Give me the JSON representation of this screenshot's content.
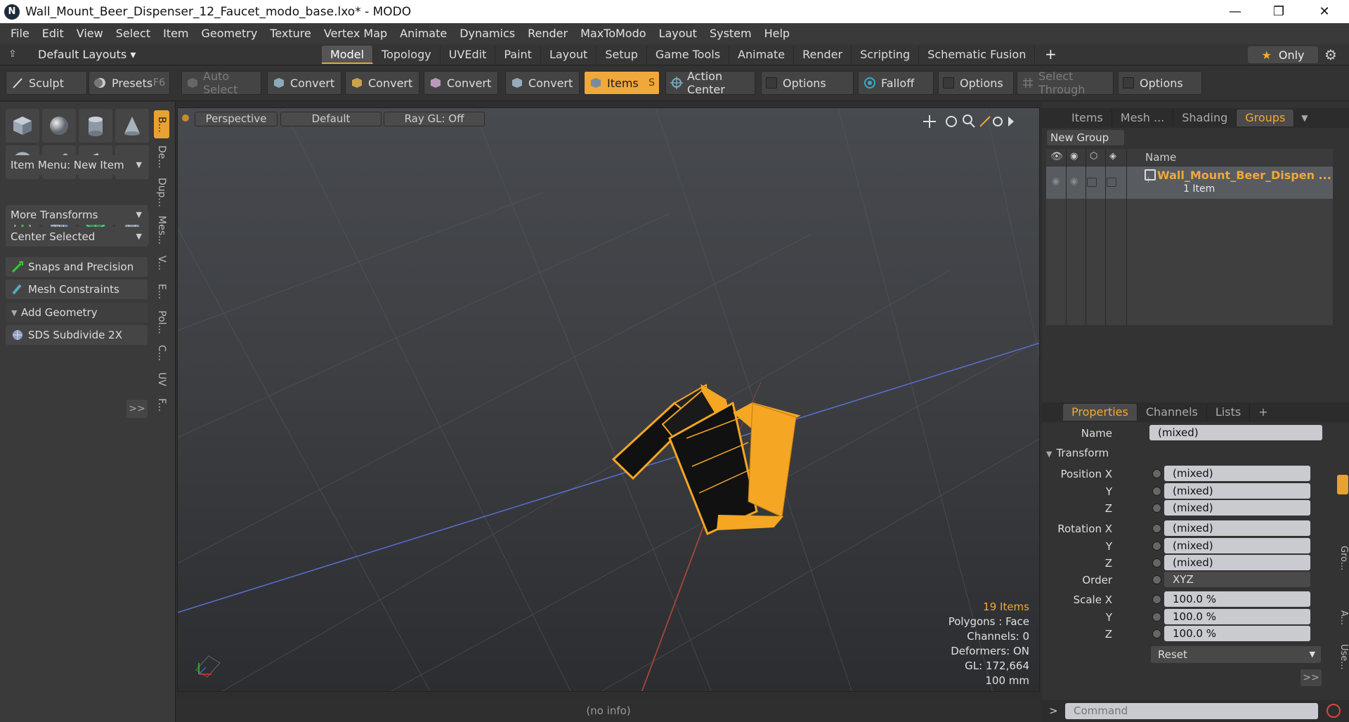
{
  "window": {
    "title": "Wall_Mount_Beer_Dispenser_12_Faucet_modo_base.lxo* - MODO",
    "logo": "N",
    "controls": [
      "—",
      "❐",
      "✕"
    ]
  },
  "menu": [
    "File",
    "Edit",
    "View",
    "Select",
    "Item",
    "Geometry",
    "Texture",
    "Vertex Map",
    "Animate",
    "Dynamics",
    "Render",
    "MaxToModo",
    "Layout",
    "System",
    "Help"
  ],
  "layout_bar": {
    "layouts_label": "Default Layouts ▾",
    "tabs": [
      "Model",
      "Topology",
      "UVEdit",
      "Paint",
      "Layout",
      "Setup",
      "Game Tools",
      "Animate",
      "Render",
      "Scripting",
      "Schematic Fusion"
    ],
    "active_tab": "Model",
    "plus": "+",
    "only_label": "Only",
    "only_star": "★"
  },
  "toolbar": {
    "sculpt": "Sculpt",
    "presets": "Presets",
    "presets_key": "F6",
    "auto_select": "Auto Select",
    "convert": "Convert",
    "items": "Items",
    "items_key": "S",
    "action_center": "Action Center",
    "options": "Options",
    "falloff": "Falloff",
    "select_through": "Select Through"
  },
  "left_panel": {
    "item_menu": "Item Menu: New Item",
    "more_transforms": "More Transforms",
    "center_selected": "Center Selected",
    "snaps": "Snaps and Precision",
    "mesh_constraints": "Mesh Constraints",
    "add_geometry": "Add Geometry",
    "sds": "SDS Subdivide 2X",
    "expand": ">>",
    "vtabs": [
      "B...",
      "De...",
      "Dup...",
      "Mes...",
      "V...",
      "E...",
      "Pol...",
      "C...",
      "UV",
      "F..."
    ]
  },
  "viewport": {
    "view": "Perspective",
    "shading": "Default",
    "raygl": "Ray GL: Off",
    "info": {
      "items": "19 Items",
      "polygons": "Polygons : Face",
      "channels": "Channels: 0",
      "deformers": "Deformers: ON",
      "gl": "GL: 172,664",
      "scale": "100 mm"
    },
    "status": "(no info)"
  },
  "groups_panel": {
    "tabs": [
      "Items",
      "Mesh ...",
      "Shading",
      "Groups"
    ],
    "active_tab": "Groups",
    "new_group": "New Group",
    "col_name": "Name",
    "group_name": "Wall_Mount_Beer_Dispen ...",
    "group_count": "1 Item"
  },
  "properties_panel": {
    "tabs": [
      "Properties",
      "Channels",
      "Lists"
    ],
    "active_tab": "Properties",
    "name_label": "Name",
    "name_value": "(mixed)",
    "transform_label": "Transform",
    "rows": [
      {
        "label": "Position X",
        "value": "(mixed)"
      },
      {
        "label": "Y",
        "value": "(mixed)"
      },
      {
        "label": "Z",
        "value": "(mixed)"
      },
      {
        "label": "Rotation X",
        "value": "(mixed)"
      },
      {
        "label": "Y",
        "value": "(mixed)"
      },
      {
        "label": "Z",
        "value": "(mixed)"
      },
      {
        "label": "Order",
        "value": "XYZ"
      },
      {
        "label": "Scale X",
        "value": "100.0 %"
      },
      {
        "label": "Y",
        "value": "100.0 %"
      },
      {
        "label": "Z",
        "value": "100.0 %"
      }
    ],
    "reset": "Reset",
    "expand": ">>",
    "side_tabs": [
      "Gro...",
      "A...",
      "Use..."
    ]
  },
  "command": {
    "prompt": ">",
    "placeholder": "Command"
  },
  "colors": {
    "accent": "#f0a83a",
    "mesh": "#f5a623"
  }
}
